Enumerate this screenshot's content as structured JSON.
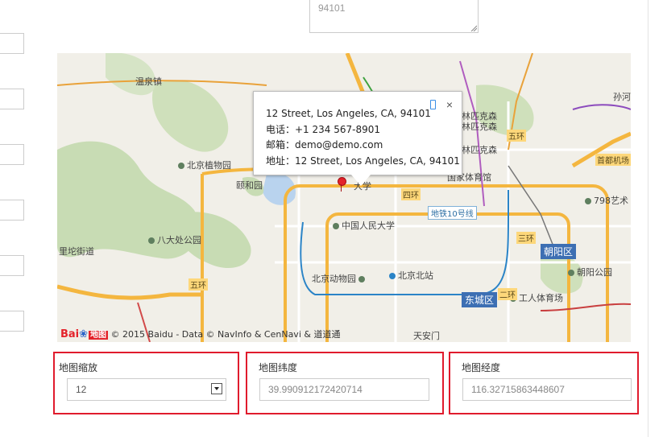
{
  "address_textarea": {
    "value": "94101"
  },
  "map": {
    "places": [
      {
        "label": "温泉镇"
      },
      {
        "label": "北京植物园"
      },
      {
        "label": "颐和园"
      },
      {
        "label": "八大处公园"
      },
      {
        "label": "里坨街道"
      },
      {
        "label": "北京动物园"
      },
      {
        "label": "北京北站"
      },
      {
        "label": "中国人民大学"
      },
      {
        "label": "国家体育馆"
      },
      {
        "label": "林匹克森"
      },
      {
        "label": "林匹克森"
      },
      {
        "label": "林匹克森"
      },
      {
        "label": "798艺术"
      },
      {
        "label": "朝阳公园"
      },
      {
        "label": "工人体育场"
      },
      {
        "label": "天安门"
      },
      {
        "label": "孙河"
      },
      {
        "label": "大学"
      }
    ],
    "roads": {
      "ring4": "四环",
      "ring5": "五环",
      "ring3": "三环",
      "ring2": "二环",
      "ring5_west": "五环",
      "airport": "首都机场"
    },
    "districts": {
      "chaoyang": "朝阳区",
      "dongcheng": "东城区"
    },
    "metro": "地铁10号线",
    "popup": {
      "line1": "12 Street, Los Angeles, CA, 94101",
      "line2": "电话：+1 234 567-8901",
      "line3": "邮箱：demo@demo.com",
      "line4": "地址：12 Street, Los Angeles, CA, 94101",
      "close": "×"
    },
    "copyright": {
      "logo_bai": "Bai",
      "logo_paw": "❀",
      "logo_ditu": "地图",
      "text": "© 2015 Baidu - Data © NavInfo & CenNavi & 道道通"
    }
  },
  "fields": {
    "zoom": {
      "label": "地图缩放",
      "value": "12"
    },
    "latitude": {
      "label": "地图纬度",
      "value": "39.990912172420714"
    },
    "longitude": {
      "label": "地图经度",
      "value": "116.32715863448607"
    }
  },
  "colors": {
    "highlight_border": "#e01b2d",
    "ring_road": "#f4b63f",
    "district_badge": "#3d6fb3"
  }
}
